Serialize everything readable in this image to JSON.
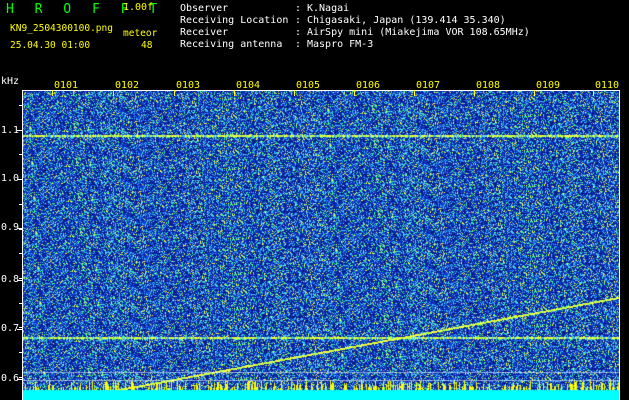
{
  "header": {
    "app_title": "H R O F F T",
    "version": "1.00f",
    "filename": "KN9_2504300100.png",
    "meteor_label": "meteor",
    "datetime": "25.04.30 01:00",
    "meteor_count": "48"
  },
  "info": [
    {
      "key": "Observer",
      "value": "K.Nagai"
    },
    {
      "key": "Receiving Location",
      "value": "Chigasaki, Japan (139.414 35.340)"
    },
    {
      "key": "Receiver",
      "value": "AirSpy mini (Miakejima VOR 108.65MHz)"
    },
    {
      "key": "Receiving antenna",
      "value": "Maspro FM-3"
    }
  ],
  "info_separator": ":",
  "spectrogram": {
    "unit": "kHz",
    "y_axis": {
      "min": 0.57,
      "max": 1.17,
      "ticks": [
        "1.1",
        "1.0",
        "0.9",
        "0.8",
        "0.7",
        "0.6"
      ]
    },
    "x_axis": {
      "labels": [
        "0101",
        "0102",
        "0103",
        "0104",
        "0105",
        "0106",
        "0107",
        "0108",
        "0109",
        "0110"
      ]
    },
    "carrier_lines_khz": [
      1.08,
      0.69
    ],
    "drifting_signal": {
      "start_khz": 0.585,
      "end_khz": 0.77
    },
    "colors": {
      "background": "#0a1a8c",
      "noise_bright": "#ffff40",
      "noise_mid": "#40ff80",
      "noise_cyan": "#40c0ff",
      "carrier": "#c0ff40",
      "baseline": "#00ffff",
      "axis_x": "#ffff00",
      "axis_y": "#ffffff"
    }
  }
}
